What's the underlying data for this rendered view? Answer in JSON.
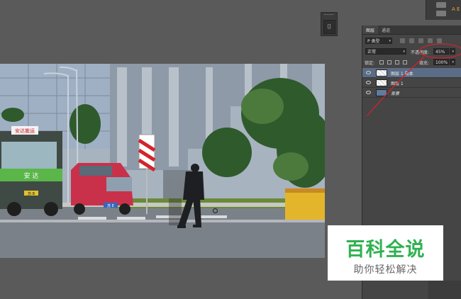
{
  "colors": {
    "workspace": "#5a5a5a",
    "panel": "#454545",
    "selected_layer": "#5b6d86",
    "annotation": "#d8202a",
    "watermark_green": "#2fb151"
  },
  "top_right": {
    "label": "A E",
    "icons": [
      "tool-icon",
      "tool-icon"
    ]
  },
  "mini_toolbar": {
    "tool_icon": "bracket-tool-icon",
    "glyph": "⌷"
  },
  "layers_panel": {
    "tabs": [
      "图层",
      "通道"
    ],
    "filter": {
      "value": "P 类型",
      "icons": [
        "image-filter-icon",
        "adjust-filter-icon",
        "type-filter-icon",
        "shape-filter-icon",
        "smart-filter-icon"
      ]
    },
    "blend_mode": "正常",
    "opacity_label": "不透明度:",
    "opacity_value": "45%",
    "lock_label": "锁定:",
    "fill_label": "填充:",
    "fill_value": "100%",
    "layers": [
      {
        "name": "图层 1 副本",
        "selected": true
      },
      {
        "name": "图层 1",
        "selected": false
      },
      {
        "name": "背景",
        "selected": false
      }
    ]
  },
  "photo": {
    "truck_sign": "安达搬运",
    "truck_side_text": "安 达",
    "truck_plate": "苏·B",
    "van_plate": "苏 E"
  },
  "watermark": {
    "title": "百科全说",
    "subtitle": "助你轻松解决"
  }
}
